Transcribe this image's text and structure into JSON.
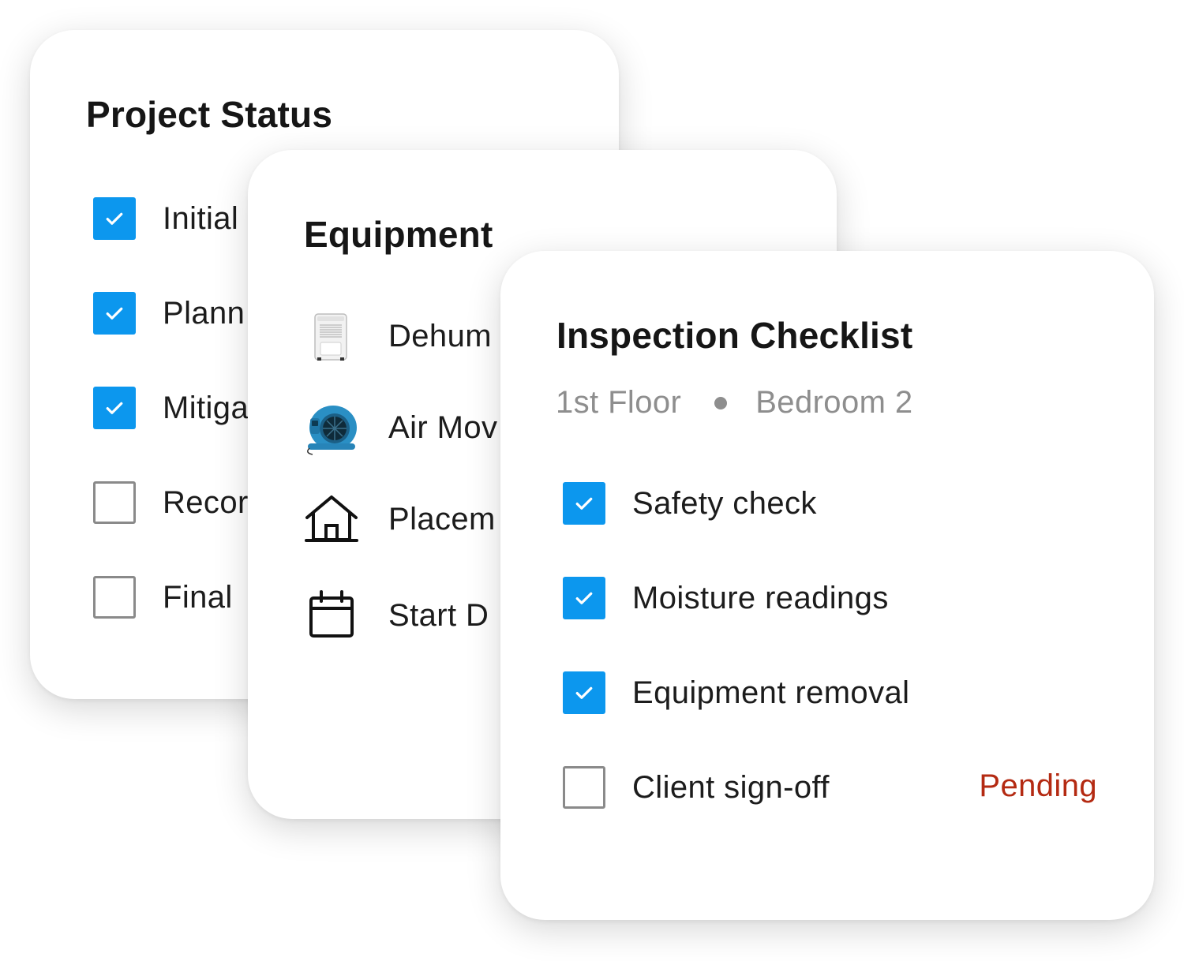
{
  "project_status": {
    "title": "Project Status",
    "items": [
      {
        "label": "Initial",
        "checked": true
      },
      {
        "label": "Plann",
        "checked": true
      },
      {
        "label": "Mitiga",
        "checked": true
      },
      {
        "label": "Recor",
        "checked": false
      },
      {
        "label": "Final",
        "checked": false
      }
    ]
  },
  "equipment": {
    "title": "Equipment",
    "items": [
      {
        "label": "Dehum",
        "icon": "dehumidifier-icon"
      },
      {
        "label": "Air Mov",
        "icon": "air-mover-icon"
      },
      {
        "label": "Placem",
        "icon": "house-icon"
      },
      {
        "label": "Start D",
        "icon": "calendar-icon"
      }
    ]
  },
  "inspection": {
    "title": "Inspection Checklist",
    "breadcrumb": {
      "floor": "1st Floor",
      "room": "Bedroom 2"
    },
    "items": [
      {
        "label": "Safety check",
        "checked": true
      },
      {
        "label": "Moisture readings",
        "checked": true
      },
      {
        "label": "Equipment removal",
        "checked": true
      },
      {
        "label": "Client sign-off",
        "checked": false,
        "status": "Pending"
      }
    ]
  },
  "colors": {
    "accent": "#0c97ee",
    "pending": "#b42a12",
    "muted": "#8e8e8e",
    "text": "#1c1c1c"
  }
}
